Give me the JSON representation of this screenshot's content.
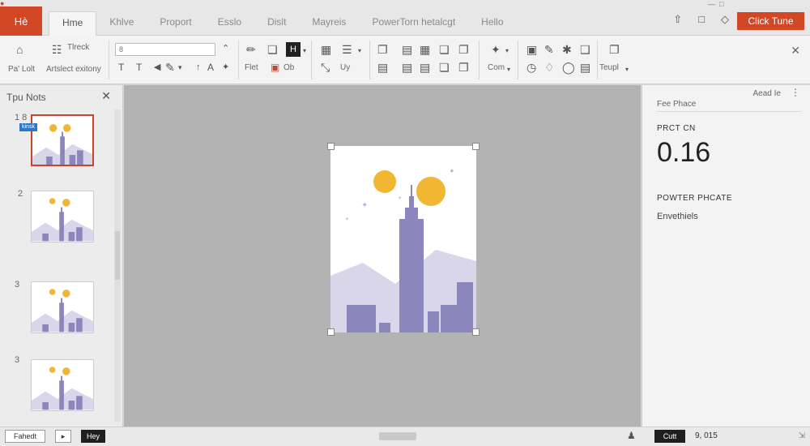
{
  "app": {
    "button_label": "Hè",
    "tabs": [
      "Hme",
      "Khlve",
      "Proport",
      "Esslo",
      "Dislt",
      "Mayreis",
      "PowerTorn hetalcgt",
      "Hello"
    ],
    "cta_label": "Click Tune"
  },
  "ribbon": {
    "labels": {
      "paste": "Pa' Lolt",
      "autoselect": "Artslect exitony",
      "check": "Tlreck",
      "flet": "Flet",
      "ob": "Ob",
      "uy": "Uy",
      "com": "Com",
      "teupl": "Teupl"
    },
    "font_box_value": "8"
  },
  "left_panel": {
    "title": "Tpu Nots",
    "selected_tag": "kinsk",
    "slides": [
      {
        "number": "1 8"
      },
      {
        "number": "2"
      },
      {
        "number": "3"
      },
      {
        "number": "3"
      }
    ]
  },
  "right_panel": {
    "add_label": "Aead Ie",
    "subtitle": "Fee Phace",
    "heading1": "PRCT CN",
    "value": "0.16",
    "heading2": "POWTER PHCATE",
    "note": "Envethiels"
  },
  "statusbar": {
    "btn1": "Fahedt",
    "btn2": "▸",
    "btn3": "Hey",
    "count_btn": "Cutt",
    "count": "9, 015"
  },
  "colors": {
    "accent": "#d24726",
    "sun": "#f1b732",
    "building": "#8b87bd",
    "hills": "#d9d6ea"
  }
}
